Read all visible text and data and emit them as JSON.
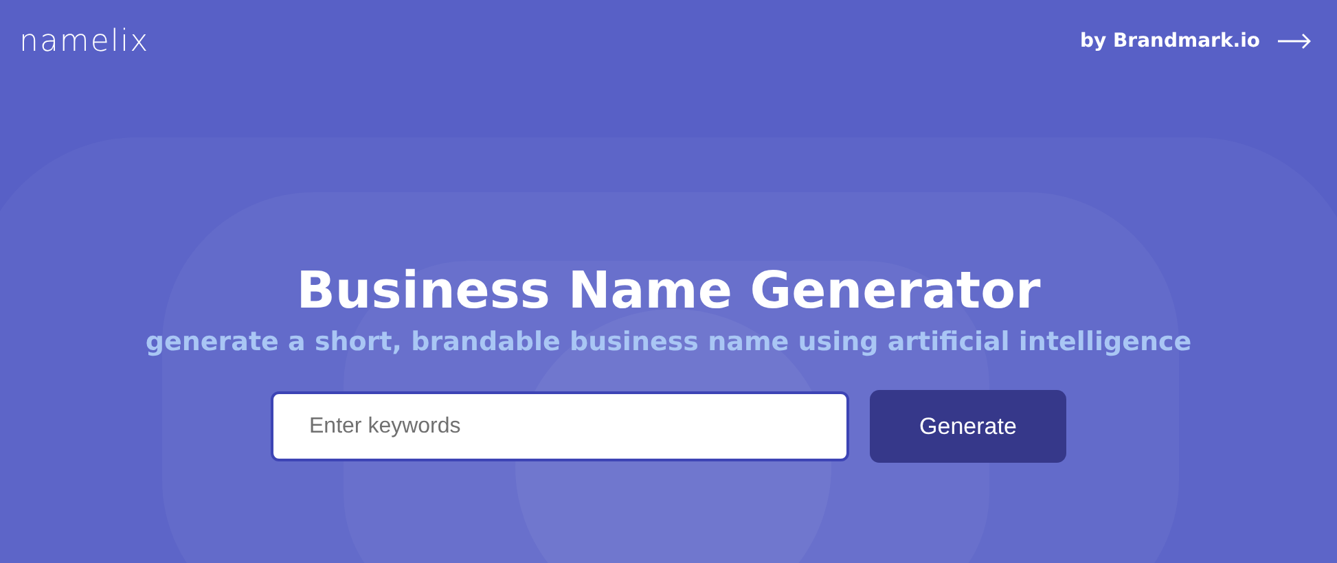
{
  "header": {
    "logo": "namelix",
    "link": "by Brandmark.io"
  },
  "hero": {
    "title": "Business Name Generator",
    "subtitle": "generate a short, brandable business name using artificial intelligence"
  },
  "search": {
    "placeholder": "Enter keywords",
    "button": "Generate"
  }
}
